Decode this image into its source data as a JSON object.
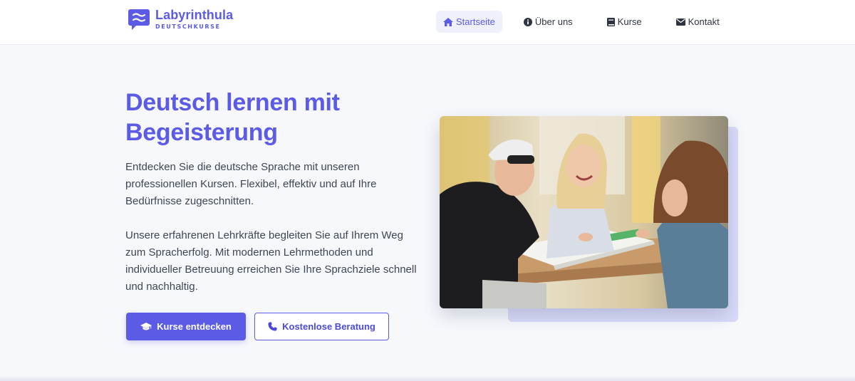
{
  "brand": {
    "name": "Labyrinthula",
    "tagline": "DEUTSCHKURSE",
    "accent_color": "#5b5be6"
  },
  "nav": {
    "items": [
      {
        "label": "Startseite",
        "icon": "home-icon",
        "active": true
      },
      {
        "label": "Über uns",
        "icon": "info-circle-icon",
        "active": false
      },
      {
        "label": "Kurse",
        "icon": "book-icon",
        "active": false
      },
      {
        "label": "Kontakt",
        "icon": "envelope-icon",
        "active": false
      }
    ]
  },
  "hero": {
    "title_line1": "Deutsch lernen mit",
    "title_line2": "Begeisterung",
    "paragraph1": "Entdecken Sie die deutsche Sprache mit unseren professionellen Kursen. Flexibel, effektiv und auf Ihre Bedürfnisse zugeschnitten.",
    "paragraph2": "Unsere erfahrenen Lehrkräfte begleiten Sie auf Ihrem Weg zum Spracherfolg. Mit modernen Lehrmethoden und individueller Betreuung erreichen Sie Ihre Sprachziele schnell und nachhaltig.",
    "primary_button": {
      "label": "Kurse entdecken",
      "icon": "graduation-cap-icon"
    },
    "secondary_button": {
      "label": "Kostenlose Beratung",
      "icon": "phone-icon"
    },
    "image": {
      "subject": "students-studying-photo"
    }
  }
}
